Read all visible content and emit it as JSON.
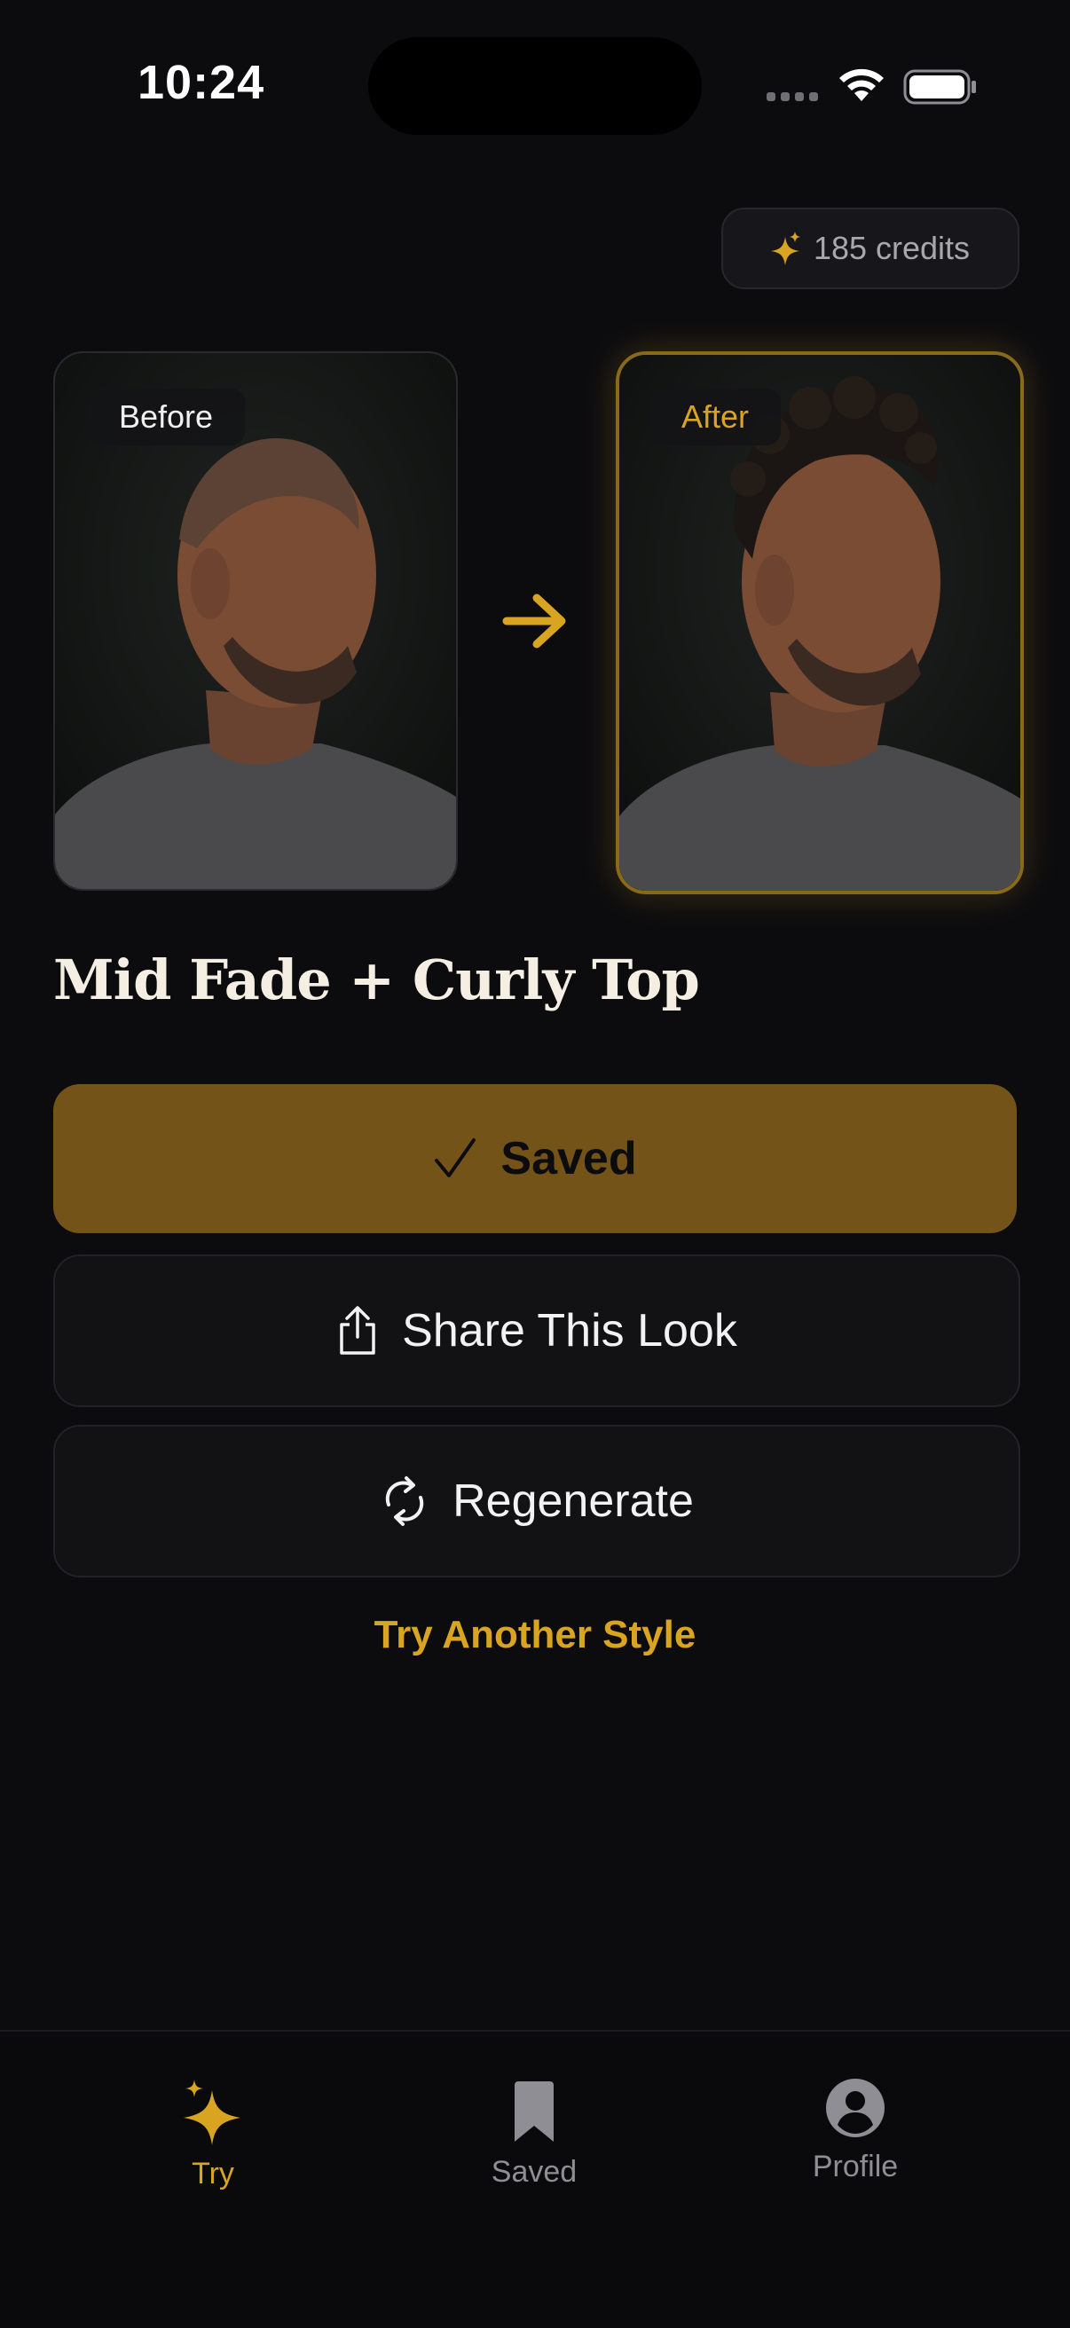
{
  "status_bar": {
    "time": "10:24"
  },
  "credits": {
    "label": "185 credits"
  },
  "photos": {
    "before_label": "Before",
    "after_label": "After"
  },
  "style": {
    "name": "Mid Fade + Curly Top"
  },
  "actions": {
    "saved_label": "Saved",
    "share_label": "Share This Look",
    "regenerate_label": "Regenerate",
    "try_another_label": "Try Another Style"
  },
  "tabbar": {
    "items": [
      {
        "label": "Try",
        "icon": "sparkles-icon",
        "active": true
      },
      {
        "label": "Saved",
        "icon": "bookmark-icon",
        "active": false
      },
      {
        "label": "Profile",
        "icon": "person-circle-icon",
        "active": false
      }
    ]
  },
  "colors": {
    "accent": "#d9a520",
    "saved_button": "#735317",
    "background": "#0c0c0f"
  }
}
